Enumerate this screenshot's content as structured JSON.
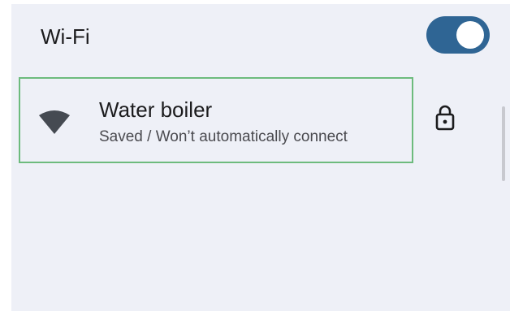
{
  "wifi": {
    "title": "Wi-Fi",
    "enabled": true,
    "toggle_color": "#2f6594"
  },
  "network": {
    "name": "Water boiler",
    "status": "Saved / Won’t automatically connect",
    "signal_icon": "wifi-signal-icon",
    "security_icon": "lock-icon",
    "highlight_color": "#6dbb7d"
  }
}
